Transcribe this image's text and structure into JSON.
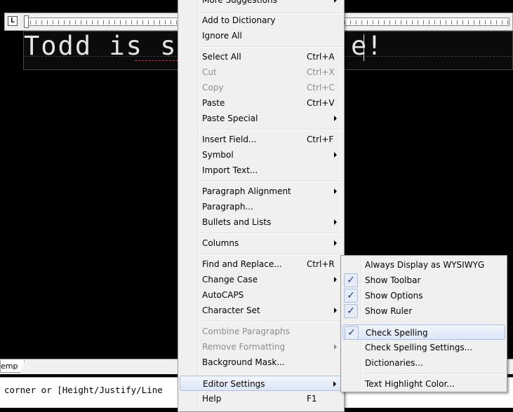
{
  "ruler": {
    "corner_glyph": "L"
  },
  "editor": {
    "text_left": "Todd is soo",
    "text_right": "e!",
    "misspelled_hint": "soo"
  },
  "tab": {
    "label": "emp"
  },
  "command_line": {
    "text": "corner or [Height/Justify/Line"
  },
  "context_menu": {
    "more_suggestions": "More Suggestions",
    "add_to_dictionary": "Add to Dictionary",
    "ignore_all": "Ignore All",
    "select_all": "Select All",
    "select_all_sc": "Ctrl+A",
    "cut": "Cut",
    "cut_sc": "Ctrl+X",
    "copy": "Copy",
    "copy_sc": "Ctrl+C",
    "paste": "Paste",
    "paste_sc": "Ctrl+V",
    "paste_special": "Paste Special",
    "insert_field": "Insert Field...",
    "insert_field_sc": "Ctrl+F",
    "symbol": "Symbol",
    "import_text": "Import Text...",
    "paragraph_alignment": "Paragraph Alignment",
    "paragraph": "Paragraph...",
    "bullets_and_lists": "Bullets and Lists",
    "columns": "Columns",
    "find_and_replace": "Find and Replace...",
    "find_and_replace_sc": "Ctrl+R",
    "change_case": "Change Case",
    "autocaps": "AutoCAPS",
    "character_set": "Character Set",
    "combine_paragraphs": "Combine Paragraphs",
    "remove_formatting": "Remove Formatting",
    "background_mask": "Background Mask...",
    "editor_settings": "Editor Settings",
    "help": "Help",
    "help_sc": "F1"
  },
  "submenu": {
    "always_display_wysiwyg": "Always Display as WYSIWYG",
    "show_toolbar": "Show Toolbar",
    "show_options": "Show Options",
    "show_ruler": "Show Ruler",
    "check_spelling": "Check Spelling",
    "check_spelling_settings": "Check Spelling Settings...",
    "dictionaries": "Dictionaries...",
    "text_highlight_color": "Text Highlight Color...",
    "check_glyph": "✓"
  }
}
